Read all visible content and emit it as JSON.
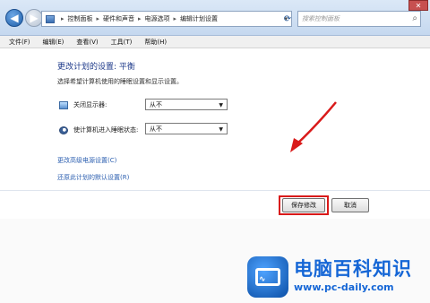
{
  "address_bar": {
    "breadcrumbs": [
      "控制面板",
      "硬件和声音",
      "电源选项",
      "编辑计划设置"
    ]
  },
  "search": {
    "placeholder": "搜索控制面板"
  },
  "menu": {
    "items": [
      "文件(F)",
      "编辑(E)",
      "查看(V)",
      "工具(T)",
      "帮助(H)"
    ]
  },
  "main": {
    "heading": "更改计划的设置: 平衡",
    "description": "选择希望计算机使用的睡眠设置和显示设置。",
    "settings": [
      {
        "label": "关闭显示器:",
        "value": "从不",
        "icon": "monitor-icon"
      },
      {
        "label": "使计算机进入睡眠状态:",
        "value": "从不",
        "icon": "sleep-icon"
      }
    ],
    "links": [
      "更改高级电源设置(C)",
      "还原此计划的默认设置(R)"
    ],
    "buttons": {
      "save": "保存修改",
      "cancel": "取消"
    }
  },
  "colors": {
    "highlight": "#d91a1a",
    "link": "#2c5fb0",
    "logo": "#1566d6"
  },
  "watermark": {
    "title": "电脑百科知识",
    "url": "www.pc-daily.com"
  }
}
